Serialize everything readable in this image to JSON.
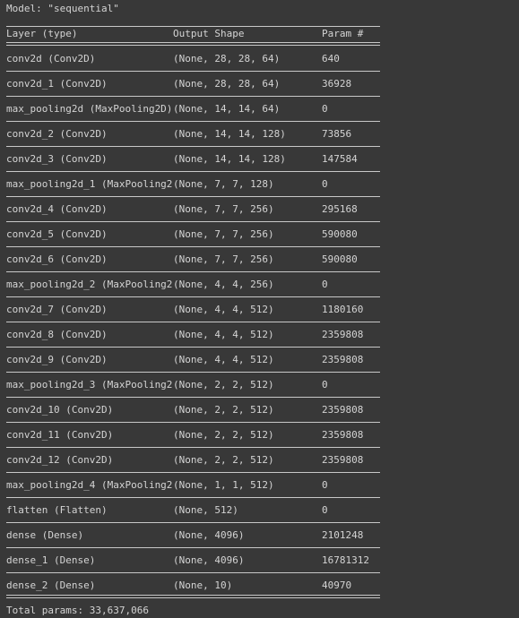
{
  "model": {
    "title": "Model: \"sequential\""
  },
  "header": {
    "col_layer": "Layer (type)",
    "col_output": "Output Shape",
    "col_params": "Param #"
  },
  "rows": [
    {
      "layer": "conv2d (Conv2D)",
      "shape": "(None, 28, 28, 64)",
      "params": "640"
    },
    {
      "layer": "conv2d_1 (Conv2D)",
      "shape": "(None, 28, 28, 64)",
      "params": "36928"
    },
    {
      "layer": "max_pooling2d (MaxPooling2D)",
      "shape": "(None, 14, 14, 64)",
      "params": "0"
    },
    {
      "layer": "conv2d_2 (Conv2D)",
      "shape": "(None, 14, 14, 128)",
      "params": "73856"
    },
    {
      "layer": "conv2d_3 (Conv2D)",
      "shape": "(None, 14, 14, 128)",
      "params": "147584"
    },
    {
      "layer": "max_pooling2d_1 (MaxPooling2",
      "shape": "(None, 7, 7, 128)",
      "params": "0"
    },
    {
      "layer": "conv2d_4 (Conv2D)",
      "shape": "(None, 7, 7, 256)",
      "params": "295168"
    },
    {
      "layer": "conv2d_5 (Conv2D)",
      "shape": "(None, 7, 7, 256)",
      "params": "590080"
    },
    {
      "layer": "conv2d_6 (Conv2D)",
      "shape": "(None, 7, 7, 256)",
      "params": "590080"
    },
    {
      "layer": "max_pooling2d_2 (MaxPooling2",
      "shape": "(None, 4, 4, 256)",
      "params": "0"
    },
    {
      "layer": "conv2d_7 (Conv2D)",
      "shape": "(None, 4, 4, 512)",
      "params": "1180160"
    },
    {
      "layer": "conv2d_8 (Conv2D)",
      "shape": "(None, 4, 4, 512)",
      "params": "2359808"
    },
    {
      "layer": "conv2d_9 (Conv2D)",
      "shape": "(None, 4, 4, 512)",
      "params": "2359808"
    },
    {
      "layer": "max_pooling2d_3 (MaxPooling2",
      "shape": "(None, 2, 2, 512)",
      "params": "0"
    },
    {
      "layer": "conv2d_10 (Conv2D)",
      "shape": "(None, 2, 2, 512)",
      "params": "2359808"
    },
    {
      "layer": "conv2d_11 (Conv2D)",
      "shape": "(None, 2, 2, 512)",
      "params": "2359808"
    },
    {
      "layer": "conv2d_12 (Conv2D)",
      "shape": "(None, 2, 2, 512)",
      "params": "2359808"
    },
    {
      "layer": "max_pooling2d_4 (MaxPooling2",
      "shape": "(None, 1, 1, 512)",
      "params": "0"
    },
    {
      "layer": "flatten (Flatten)",
      "shape": "(None, 512)",
      "params": "0"
    },
    {
      "layer": "dense (Dense)",
      "shape": "(None, 4096)",
      "params": "2101248"
    },
    {
      "layer": "dense_1 (Dense)",
      "shape": "(None, 4096)",
      "params": "16781312"
    },
    {
      "layer": "dense_2 (Dense)",
      "shape": "(None, 10)",
      "params": "40970"
    }
  ],
  "footer": {
    "total_params": "Total params: 33,637,066"
  }
}
